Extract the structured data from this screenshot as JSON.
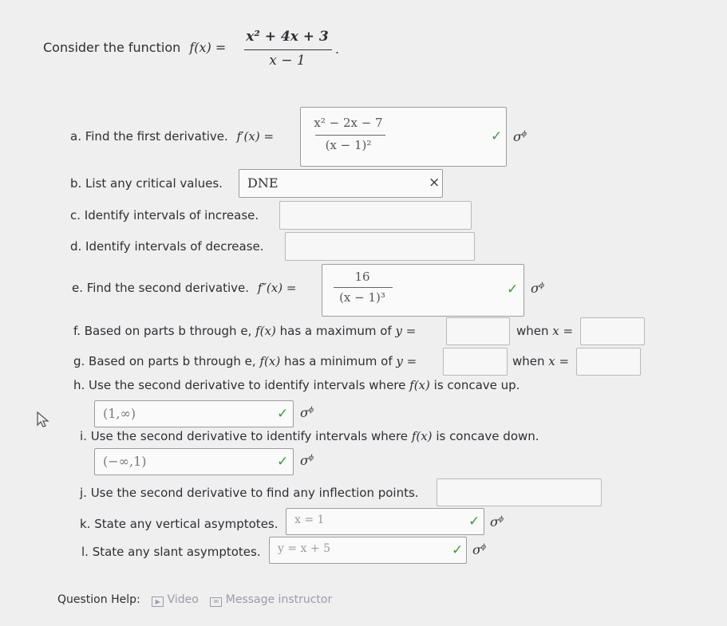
{
  "intro": {
    "text": "Consider the function",
    "fname": "f(x) =",
    "numerator": "x² + 4x + 3",
    "denominator": "x − 1",
    "period": "."
  },
  "parts": {
    "a": {
      "label": "a. Find the first derivative.",
      "math": "f′(x) =",
      "answer_num": "x² − 2x − 7",
      "answer_den": "(x − 1)²",
      "status": "correct"
    },
    "b": {
      "label": "b. List any critical values.",
      "answer": "DNE",
      "status": "incorrect"
    },
    "c": {
      "label": "c. Identify intervals of increase.",
      "answer": ""
    },
    "d": {
      "label": "d. Identify intervals of decrease.",
      "answer": ""
    },
    "e": {
      "label": "e. Find the second derivative.",
      "math": "f″(x) =",
      "answer_num": "16",
      "answer_den": "(x − 1)³",
      "status": "correct"
    },
    "f": {
      "label_pre": "f. Based on parts b through e,",
      "fx": "f(x)",
      "label_mid": "has a maximum of",
      "y_eq": "y =",
      "when": "when",
      "x_eq": "x =",
      "y_answer": "",
      "x_answer": ""
    },
    "g": {
      "label_pre": "g. Based on parts b through e,",
      "fx": "f(x)",
      "label_mid": "has a minimum of",
      "y_eq": "y =",
      "when": "when",
      "x_eq": "x =",
      "y_answer": "",
      "x_answer": ""
    },
    "h": {
      "label_pre": "h. Use the second derivative to identify intervals where",
      "fx": "f(x)",
      "label_post": "is concave up.",
      "answer": "(1,∞)",
      "status": "correct"
    },
    "i": {
      "label_pre": "i. Use the second derivative to identify intervals where",
      "fx": "f(x)",
      "label_post": "is concave down.",
      "answer": "(−∞,1)",
      "status": "correct"
    },
    "j": {
      "label": "j. Use the second derivative to find any inflection points.",
      "answer": ""
    },
    "k": {
      "label": "k. State any vertical asymptotes.",
      "answer": "x = 1",
      "status": "correct"
    },
    "l": {
      "label": "l. State any slant asymptotes.",
      "answer": "y = x + 5",
      "status": "correct"
    }
  },
  "icons": {
    "check": "✓",
    "cross": "×",
    "sigma": "σ",
    "sigma_sup": "ϕ"
  },
  "help": {
    "label": "Question Help:",
    "video": "Video",
    "message": "Message instructor"
  },
  "colors": {
    "check": "#3d9a3d",
    "link": "#9b9ba8",
    "background": "#efeff0"
  }
}
